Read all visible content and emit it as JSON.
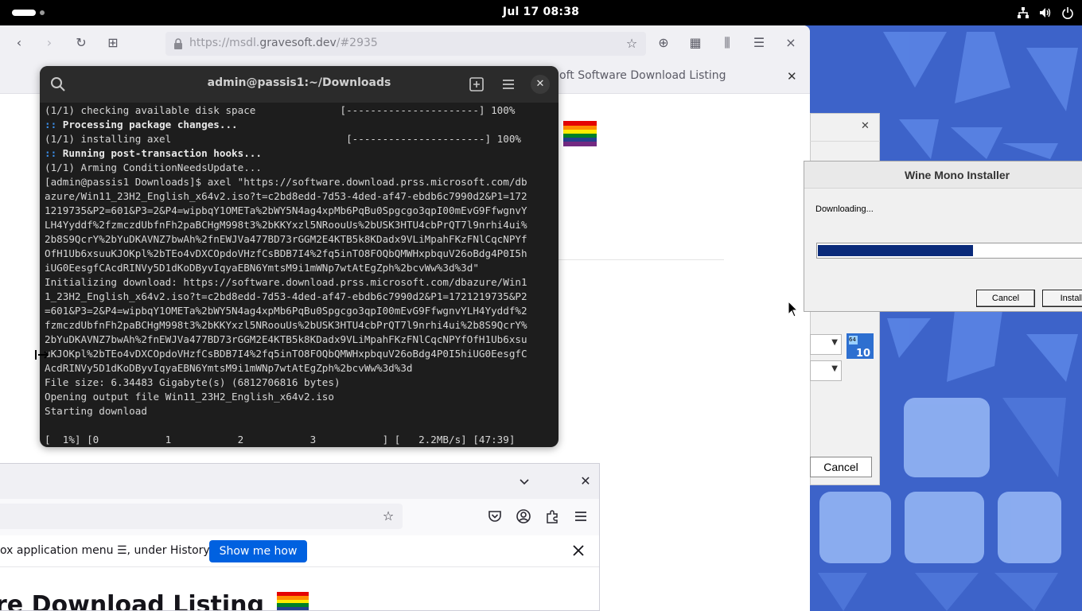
{
  "topbar": {
    "clock": "Jul 17  08:38",
    "tray_icons": [
      "network-icon",
      "volume-icon",
      "power-icon"
    ]
  },
  "browser_back": {
    "url_prefix": "https://msdl.",
    "url_domain": "gravesoft.dev",
    "url_suffix": "/#2935",
    "tab_title": "oft Software Download Listing"
  },
  "terminal": {
    "title": "admin@passis1:~/Downloads",
    "lines": [
      {
        "text": "(1/1) checking available disk space              [----------------------] 100%",
        "style": "normal"
      },
      {
        "prefix": "::",
        "text": " Processing package changes...",
        "style": "bold"
      },
      {
        "text": "(1/1) installing axel                             [----------------------] 100%",
        "style": "normal"
      },
      {
        "prefix": "::",
        "text": " Running post-transaction hooks...",
        "style": "bold"
      },
      {
        "text": "(1/1) Arming ConditionNeedsUpdate...",
        "style": "normal"
      },
      {
        "text": "[admin@passis1 Downloads]$ axel \"https://software.download.prss.microsoft.com/db",
        "style": "normal"
      },
      {
        "text": "azure/Win11_23H2_English_x64v2.iso?t=c2bd8edd-7d53-4ded-af47-ebdb6c7990d2&P1=172",
        "style": "normal"
      },
      {
        "text": "1219735&P2=601&P3=2&P4=wipbqY1OMETa%2bWY5N4ag4xpMb6PqBu0Spgcgo3qpI00mEvG9FfwgnvY",
        "style": "normal"
      },
      {
        "text": "LH4Yyddf%2fzmczdUbfnFh2paBCHgM998t3%2bKKYxzl5NRoouUs%2bUSK3HTU4cbPrQT7l9nrhi4ui%",
        "style": "normal"
      },
      {
        "text": "2b8S9QcrY%2bYuDKAVNZ7bwAh%2fnEWJVa477BD73rGGM2E4KTB5k8KDadx9VLiMpahFKzFNlCqcNPYf",
        "style": "normal"
      },
      {
        "text": "OfH1Ub6xsuuKJOKpl%2bTEo4vDXCOpdoVHzfCsBDB7I4%2fq5inTO8FOQbQMWHxpbquV26oBdg4P0I5h",
        "style": "normal"
      },
      {
        "text": "iUG0EesgfCAcdRINVy5D1dKoDByvIqyaEBN6YmtsM9i1mWNp7wtAtEgZph%2bcvWw%3d%3d\"",
        "style": "normal"
      },
      {
        "text": "Initializing download: https://software.download.prss.microsoft.com/dbazure/Win1",
        "style": "normal"
      },
      {
        "text": "1_23H2_English_x64v2.iso?t=c2bd8edd-7d53-4ded-af47-ebdb6c7990d2&P1=1721219735&P2",
        "style": "normal"
      },
      {
        "text": "=601&P3=2&P4=wipbqY1OMETa%2bWY5N4ag4xpMb6PqBu0Spgcgo3qpI00mEvG9FfwgnvYLH4Yyddf%2",
        "style": "normal"
      },
      {
        "text": "fzmczdUbfnFh2paBCHgM998t3%2bKKYxzl5NRoouUs%2bUSK3HTU4cbPrQT7l9nrhi4ui%2b8S9QcrY%",
        "style": "normal"
      },
      {
        "text": "2bYuDKAVNZ7bwAh%2fnEWJVa477BD73rGGM2E4KTB5k8KDadx9VLiMpahFKzFNlCqcNPYfOfH1Ub6xsu",
        "style": "normal"
      },
      {
        "text": "uKJOKpl%2bTEo4vDXCOpdoVHzfCsBDB7I4%2fq5inTO8FOQbQMWHxpbquV26oBdg4P0I5hiUG0EesgfC",
        "style": "normal"
      },
      {
        "text": "AcdRINVy5D1dKoDByvIqyaEBN6YmtsM9i1mWNp7wtAtEgZph%2bcvWw%3d%3d",
        "style": "normal"
      },
      {
        "text": "File size: 6.34483 Gigabyte(s) (6812706816 bytes)",
        "style": "normal"
      },
      {
        "text": "Opening output file Win11_23H2_English_x64v2.iso",
        "style": "normal"
      },
      {
        "text": "Starting download",
        "style": "normal"
      },
      {
        "text": "",
        "style": "normal"
      },
      {
        "text": "[  1%] [0           1           2           3           ] [   2.2MB/s] [47:39]",
        "style": "normal"
      }
    ]
  },
  "wine_back": {
    "cancel_label": "Cancel",
    "icon_label_top": "64",
    "icon_label": "10"
  },
  "mono_installer": {
    "title": "Wine Mono Installer",
    "status": "Downloading...",
    "progress": 0.58,
    "cancel_label": "Cancel",
    "install_label": "Install"
  },
  "browser_front": {
    "notice_text": "ox application menu ☰, under History.",
    "show_me_label": "Show me how",
    "heading": "re Download Listing"
  },
  "colors": {
    "topbar": "#000000",
    "terminal_bg": "#1d1d1d",
    "accent_blue": "#0061e0",
    "progress_fill": "#0a2a7a",
    "wallpaper": "#3c63c8"
  }
}
